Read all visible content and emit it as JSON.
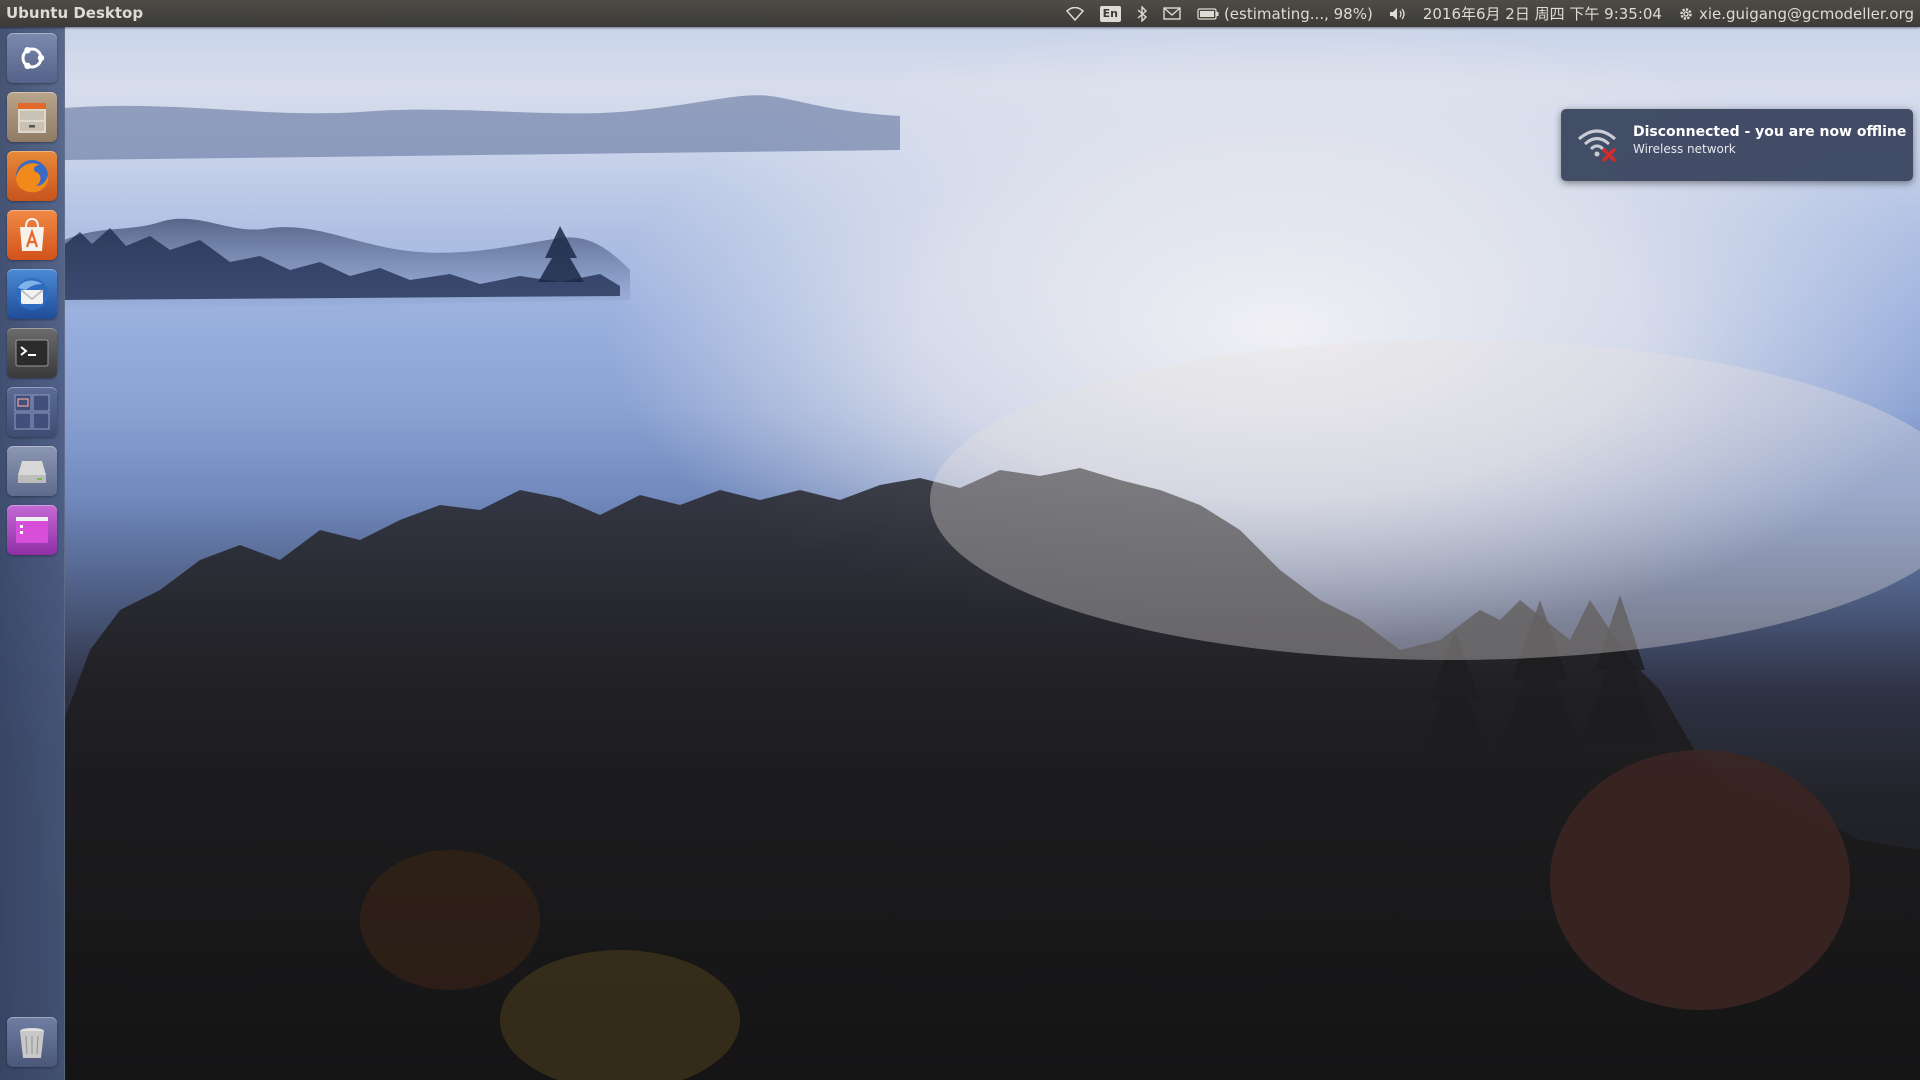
{
  "panel": {
    "title": "Ubuntu Desktop",
    "language": "En",
    "battery_text": "(estimating..., 98%)",
    "datetime": "2016年6月 2日 周四 下午 9:35:04",
    "user": "xie.guigang@gcmodeller.org",
    "icons": [
      "wifi-icon",
      "keyboard-language-icon",
      "bluetooth-icon",
      "mail-icon",
      "battery-icon",
      "volume-icon",
      "gear-icon"
    ]
  },
  "launcher": {
    "items": [
      {
        "name": "dash",
        "icon": "ubuntu-logo-icon"
      },
      {
        "name": "files",
        "icon": "file-cabinet-icon"
      },
      {
        "name": "firefox",
        "icon": "firefox-icon"
      },
      {
        "name": "software-center",
        "icon": "shopping-bag-icon"
      },
      {
        "name": "thunderbird",
        "icon": "thunderbird-icon"
      },
      {
        "name": "terminal",
        "icon": "terminal-icon"
      },
      {
        "name": "workspaces",
        "icon": "workspace-switcher-icon"
      },
      {
        "name": "drive",
        "icon": "hard-drive-icon"
      },
      {
        "name": "app",
        "icon": "magenta-window-icon"
      },
      {
        "name": "trash",
        "icon": "trash-icon"
      }
    ]
  },
  "notification": {
    "title": "Disconnected - you are now offline",
    "body": "Wireless network",
    "icon": "wifi-disconnected-icon"
  },
  "colors": {
    "panel_bg": "#3c3b37",
    "panel_text": "#dfdbd2",
    "notification_bg": "#3a445f",
    "firefox_orange": "#e66000",
    "software_center_orange": "#e9672a",
    "error_red": "#d22b2b"
  }
}
